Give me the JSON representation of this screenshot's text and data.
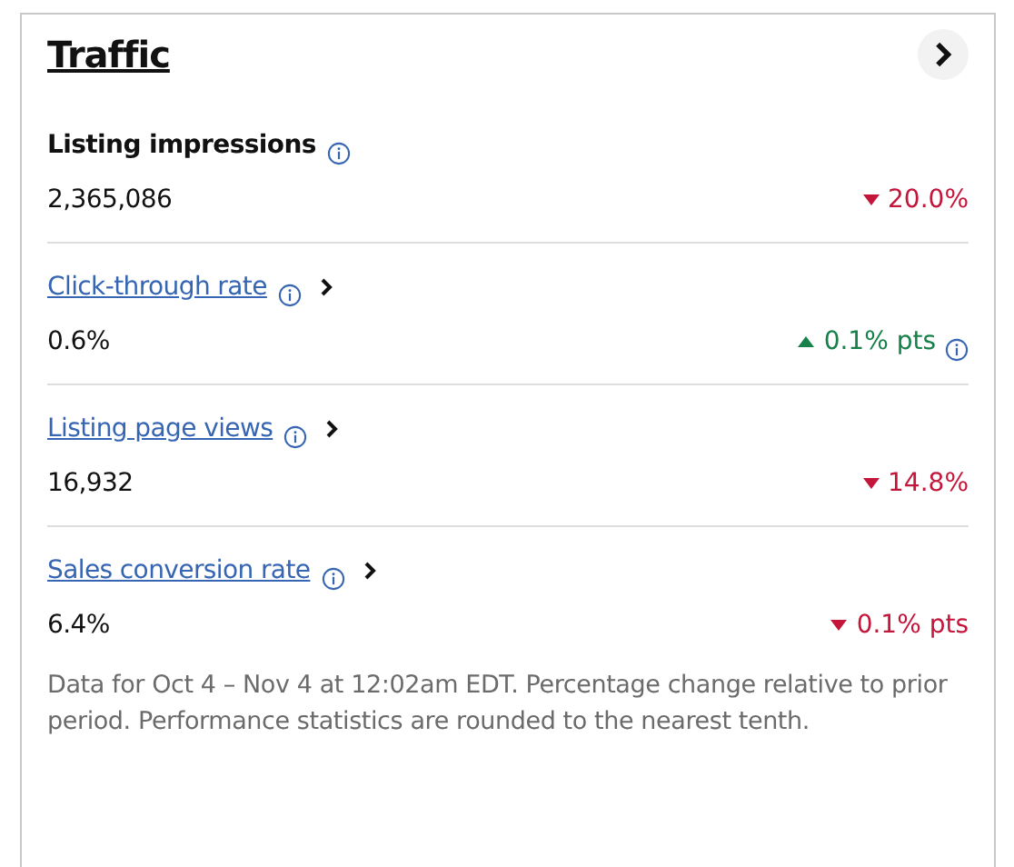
{
  "card": {
    "title": "Traffic"
  },
  "metrics": [
    {
      "kind": "plain",
      "label": "Listing impressions",
      "value": "2,365,086",
      "change": "20.0%",
      "rising": false,
      "change_info": false
    },
    {
      "kind": "link",
      "label": "Click-through rate",
      "value": "0.6%",
      "change": "0.1% pts",
      "rising": true,
      "change_info": true
    },
    {
      "kind": "link",
      "label": "Listing page views",
      "value": "16,932",
      "change": "14.8%",
      "rising": false,
      "change_info": false
    },
    {
      "kind": "link",
      "label": "Sales conversion rate",
      "value": "6.4%",
      "change": "0.1% pts",
      "rising": false,
      "change_info": false
    }
  ],
  "footnote": "Data for Oct 4 – Nov 4 at 12:02am EDT. Percentage change relative to prior period. Performance statistics are rounded to the nearest tenth."
}
